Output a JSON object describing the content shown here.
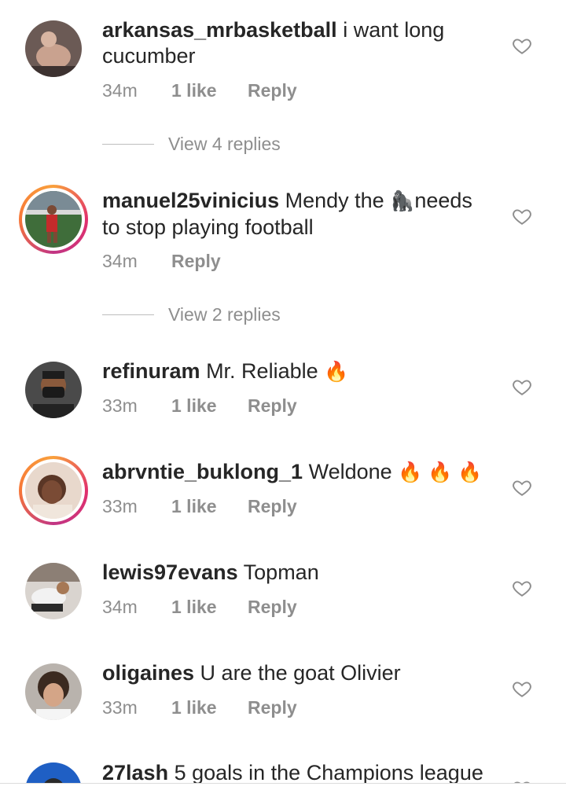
{
  "comments": [
    {
      "username": "arkansas_mrbasketball",
      "text": "i want long cucumber",
      "time": "34m",
      "likes": "1 like",
      "reply": "Reply",
      "view_replies": "View 4 replies",
      "story_ring": false
    },
    {
      "username": "manuel25vinicius",
      "text_before": "Mendy the",
      "emoji": "🦍",
      "text_after": "needs to stop playing football",
      "time": "34m",
      "reply": "Reply",
      "view_replies": "View 2 replies",
      "story_ring": true
    },
    {
      "username": "refinuram",
      "text": "Mr. Reliable",
      "emoji": "🔥",
      "time": "33m",
      "likes": "1 like",
      "reply": "Reply",
      "story_ring": false
    },
    {
      "username": "abrvntie_buklong_1",
      "text": "Weldone",
      "emoji": "🔥 🔥 🔥",
      "time": "33m",
      "likes": "1 like",
      "reply": "Reply",
      "story_ring": true
    },
    {
      "username": "lewis97evans",
      "text": "Topman",
      "time": "34m",
      "likes": "1 like",
      "reply": "Reply",
      "story_ring": false
    },
    {
      "username": "oligaines",
      "text": "U are the goat Olivier",
      "time": "33m",
      "likes": "1 like",
      "reply": "Reply",
      "story_ring": false
    },
    {
      "username": "27lash",
      "text": "5 goals in the Champions league",
      "story_ring": false
    }
  ],
  "colors": {
    "text": "#262626",
    "secondary": "#8e8e8e",
    "story_ring": [
      "#f9a03c",
      "#e1306c",
      "#c13584"
    ]
  },
  "icons": {
    "like": "heart-outline-icon"
  }
}
